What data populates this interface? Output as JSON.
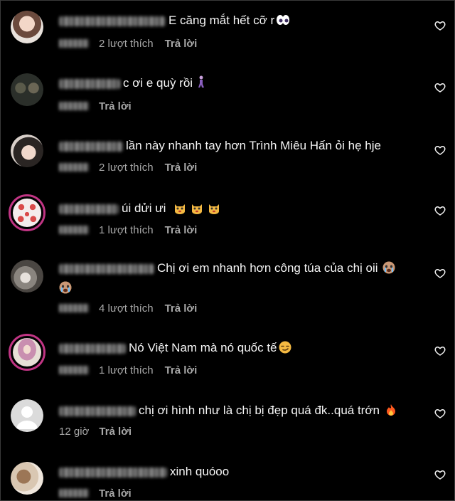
{
  "comments": [
    {
      "username_hidden": true,
      "text": "E căng mắt hết cỡ r",
      "emoji": "eyes",
      "time": "",
      "likes": "2 lượt thích",
      "reply": "Trả lời"
    },
    {
      "username_hidden": true,
      "text": "c ơi e quỳ rồi",
      "emoji": "person-kneeling",
      "time": "",
      "likes": "",
      "reply": "Trả lời"
    },
    {
      "username_hidden": true,
      "text": "lần này nhanh tay hơn Trình Miêu Hấn ỏi hẹ hje",
      "emoji": "",
      "time": "",
      "likes": "2 lượt thích",
      "reply": "Trả lời"
    },
    {
      "username_hidden": true,
      "text": "úi dửi ưi",
      "emoji": "weary-cat x3",
      "time": "",
      "likes": "1 lượt thích",
      "reply": "Trả lời"
    },
    {
      "username_hidden": true,
      "text": "Chị ơi em nhanh hơn công túa của chị oii",
      "emoji": "crying-face x2",
      "time": "",
      "likes": "4 lượt thích",
      "reply": "Trả lời"
    },
    {
      "username_hidden": true,
      "text": "Nó Việt Nam mà nó quốc tế",
      "emoji": "smirking-face",
      "time": "",
      "likes": "1 lượt thích",
      "reply": "Trả lời"
    },
    {
      "username_hidden": true,
      "text": "chị ơi hình như là chị bị đẹp quá đk..quá trớn",
      "emoji": "fire",
      "time": "12 giờ",
      "likes": "",
      "reply": "Trả lời"
    },
    {
      "username_hidden": true,
      "text": "xinh quóoo",
      "emoji": "",
      "time": "",
      "likes": "",
      "reply": "Trả lời"
    }
  ],
  "icons": {
    "like": "heart-outline-icon"
  },
  "colors": {
    "background": "#000000",
    "primary_text": "#f5f5f5",
    "secondary_text": "#a8a8a8",
    "story_ring": "#c13584"
  }
}
